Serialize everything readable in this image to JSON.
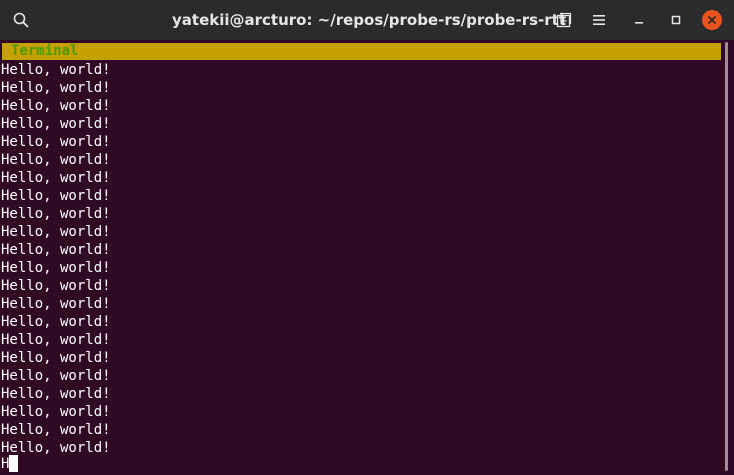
{
  "window": {
    "title": "yatekii@arcturo: ~/repos/probe-rs/probe-rs-rtt",
    "icons": {
      "search": "search-icon",
      "new_tab": "new-tab-icon",
      "menu": "hamburger-menu-icon",
      "minimize": "minimize-icon",
      "maximize": "maximize-icon",
      "close": "close-icon"
    }
  },
  "terminal": {
    "header_label": "Terminal",
    "header_color": "#c4a000",
    "header_text_color": "#4e9a06",
    "background": "#300a24",
    "lines": [
      "Hello, world!",
      "Hello, world!",
      "Hello, world!",
      "Hello, world!",
      "Hello, world!",
      "Hello, world!",
      "Hello, world!",
      "Hello, world!",
      "Hello, world!",
      "Hello, world!",
      "Hello, world!",
      "Hello, world!",
      "Hello, world!",
      "Hello, world!",
      "Hello, world!",
      "Hello, world!",
      "Hello, world!",
      "Hello, world!",
      "Hello, world!",
      "Hello, world!",
      "Hello, world!",
      "Hello, world!"
    ],
    "partial_line": "H"
  },
  "colors": {
    "titlebar": "#2b2b2b",
    "close_button": "#e95420"
  }
}
